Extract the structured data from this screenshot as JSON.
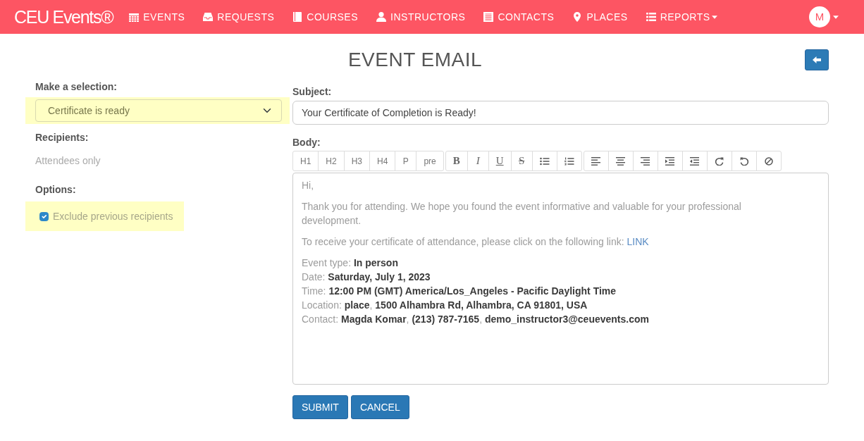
{
  "navbar": {
    "brand": "CEU Events®",
    "items": [
      {
        "label": "EVENTS",
        "has_menu": false
      },
      {
        "label": "REQUESTS",
        "has_menu": false
      },
      {
        "label": "COURSES",
        "has_menu": false
      },
      {
        "label": "INSTRUCTORS",
        "has_menu": false
      },
      {
        "label": "CONTACTS",
        "has_menu": false
      },
      {
        "label": "PLACES",
        "has_menu": false
      },
      {
        "label": "REPORTS",
        "has_menu": true
      }
    ],
    "avatar": {
      "initial": "M"
    }
  },
  "page": {
    "title": "EVENT EMAIL"
  },
  "left_panel": {
    "selection": {
      "label": "Make a selection:",
      "value": "Certificate is ready",
      "highlighted": true
    },
    "recipients": {
      "label": "Recipients:",
      "value": "Attendees only"
    },
    "options": {
      "label": "Options:",
      "items": [
        {
          "label": "Exclude previous recipients",
          "checked": true,
          "highlighted": true
        }
      ]
    }
  },
  "form": {
    "subject": {
      "label": "Subject:",
      "value": "Your Certificate of Completion is Ready!"
    },
    "body": {
      "label": "Body:",
      "toolbar": {
        "block_formats": [
          "H1",
          "H2",
          "H3",
          "H4",
          "P",
          "pre"
        ],
        "inline_formats": [
          {
            "kind": "bold",
            "label": "B"
          },
          {
            "kind": "italic",
            "label": "I"
          },
          {
            "kind": "underline",
            "label": "U"
          },
          {
            "kind": "strike",
            "label": "S"
          }
        ]
      },
      "paragraphs": [
        {
          "kind": "text",
          "text": "Hi,"
        },
        {
          "kind": "text",
          "text": "Thank you for attending. We hope you found the event informative and valuable for your professional development."
        },
        {
          "kind": "link",
          "text": "To receive your certificate of attendance, please click on the following link:",
          "link": "LINK"
        },
        {
          "kind": "details",
          "lines": [
            "Event type: **In person**",
            "Date: **Saturday, July 1, 2023**",
            "Time: **12:00 PM (GMT) America/Los_Angeles - Pacific Daylight Time**",
            "Location: **place**, **1500 Alhambra Rd, Alhambra, CA 91801, USA**",
            "Contact: **Magda Komar**, **(213) 787-7165**, **demo_instructor3@ceuevents.com**"
          ]
        }
      ]
    },
    "buttons": [
      {
        "label": "SUBMIT"
      },
      {
        "label": "CANCEL"
      }
    ]
  }
}
